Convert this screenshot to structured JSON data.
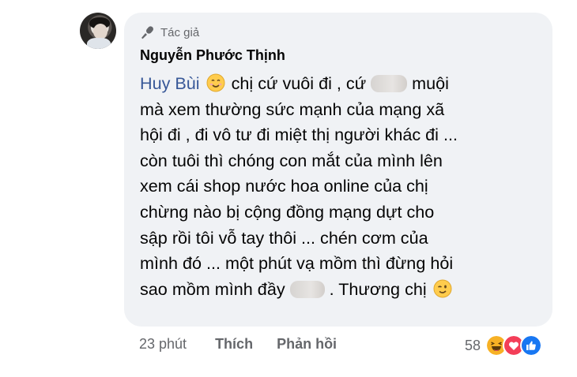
{
  "comment": {
    "badge_label": "Tác giả",
    "author": "Nguyễn Phước Thịnh",
    "mention": "Huy Bùi",
    "lines": [
      {
        "before": " chị cứ vuôi đi , cứ ",
        "after": " muội"
      },
      {
        "text": "mà xem thường sức mạnh của mạng xã"
      },
      {
        "text": "hội đi , đi vô tư đi miệt thị người khác đi ..."
      },
      {
        "text": "còn tuôi thì chóng con mắt của mình lên"
      },
      {
        "text": "xem cái shop nước hoa online của chị"
      },
      {
        "text": "chừng nào bị cộng đồng mạng dựt cho"
      },
      {
        "text": "sập rồi tôi vỗ tay thôi ... chén cơm của"
      },
      {
        "text": "mình đó ... một phút vạ mồm thì đừng hỏi"
      },
      {
        "before": "sao mồm mình đầy ",
        "after": " . Thương chị "
      }
    ],
    "time": "23 phút",
    "like_label": "Thích",
    "reply_label": "Phản hồi",
    "reaction_count": "58",
    "reaction_icons": [
      "haha-icon",
      "love-icon",
      "like-icon"
    ]
  },
  "colors": {
    "bubble": "#f0f2f5",
    "mention": "#385898",
    "meta": "#65676b",
    "text": "#050505"
  }
}
